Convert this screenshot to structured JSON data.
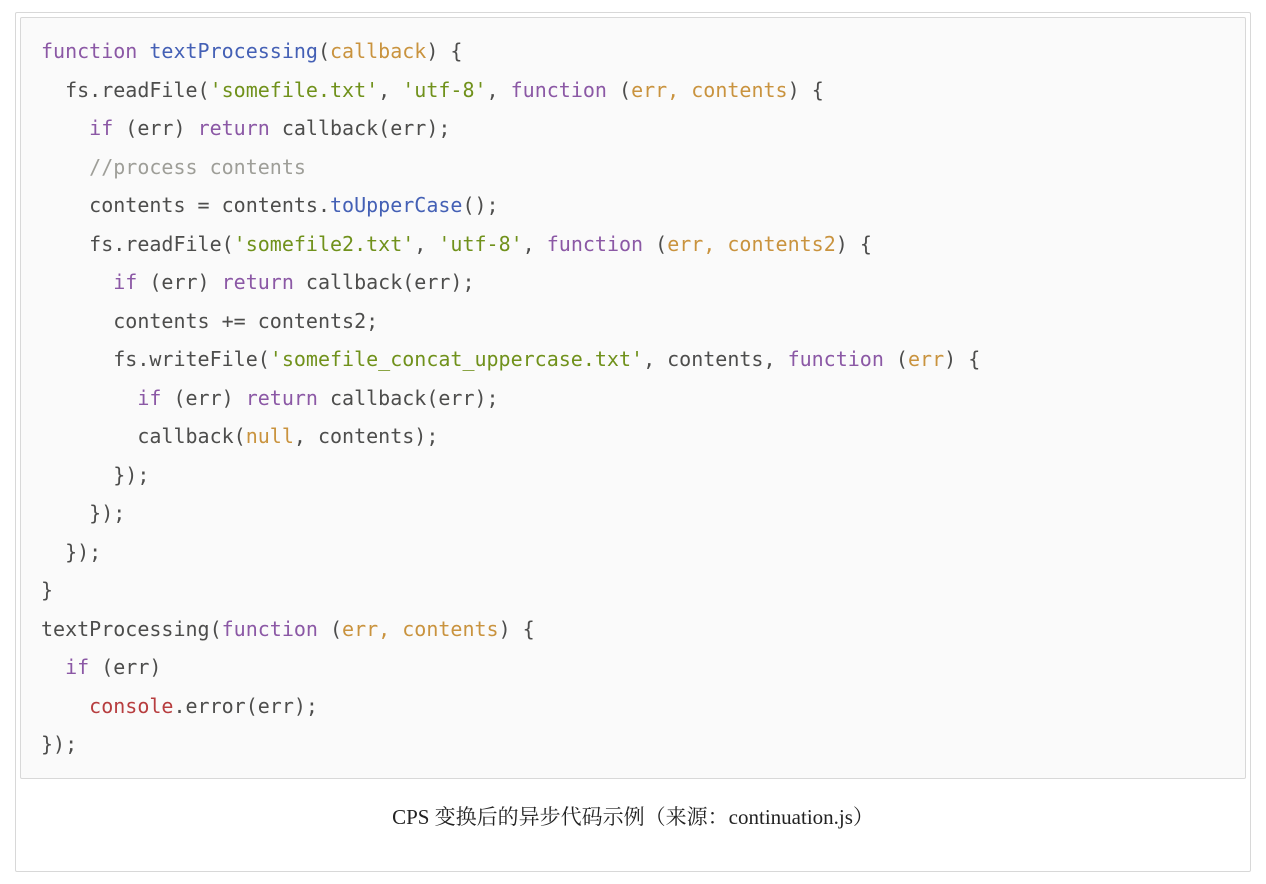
{
  "code": {
    "line1": {
      "a": "function",
      "b": "textProcessing",
      "c": "(",
      "d": "callback",
      "e": ") {"
    },
    "line2": {
      "a": "  fs.readFile(",
      "b": "'somefile.txt'",
      "c": ", ",
      "d": "'utf-8'",
      "e": ", ",
      "f": "function",
      "g": " (",
      "h": "err, contents",
      "i": ") {"
    },
    "line3": {
      "a": "    ",
      "b": "if",
      "c": " (err) ",
      "d": "return",
      "e": " callback(err);"
    },
    "line4": {
      "a": "    ",
      "b": "//process contents"
    },
    "line5": {
      "a": "    contents = contents.toUpperCase();",
      "pre": "    contents = contents.",
      "m": "toUpperCase",
      "post": "();"
    },
    "line6": {
      "a": "    fs.readFile(",
      "b": "'somefile2.txt'",
      "c": ", ",
      "d": "'utf-8'",
      "e": ", ",
      "f": "function",
      "g": " (",
      "h": "err, contents2",
      "i": ") {"
    },
    "line7": {
      "a": "      ",
      "b": "if",
      "c": " (err) ",
      "d": "return",
      "e": " callback(err);"
    },
    "line8": {
      "a": "      contents += contents2;"
    },
    "line9": {
      "a": "      fs.writeFile(",
      "b": "'somefile_concat_uppercase.txt'",
      "c": ", contents, ",
      "d": "function",
      "e": " (",
      "f": "err",
      "g": ") {"
    },
    "line10": {
      "a": "        ",
      "b": "if",
      "c": " (err) ",
      "d": "return",
      "e": " callback(err);"
    },
    "line11": {
      "a": "        callback(",
      "b": "null",
      "c": ", contents);"
    },
    "line12": {
      "a": "      });"
    },
    "line13": {
      "a": "    });"
    },
    "line14": {
      "a": "  });"
    },
    "line15": {
      "a": "}"
    },
    "line16": {
      "a": "textProcessing(",
      "b": "function",
      "c": " (",
      "d": "err, contents",
      "e": ") {"
    },
    "line17": {
      "a": "  ",
      "b": "if",
      "c": " (err)"
    },
    "line18": {
      "a": "    ",
      "b": "console",
      "c": ".error(err);"
    },
    "line19": {
      "a": "});"
    }
  },
  "caption": "CPS 变换后的异步代码示例（来源：continuation.js）"
}
